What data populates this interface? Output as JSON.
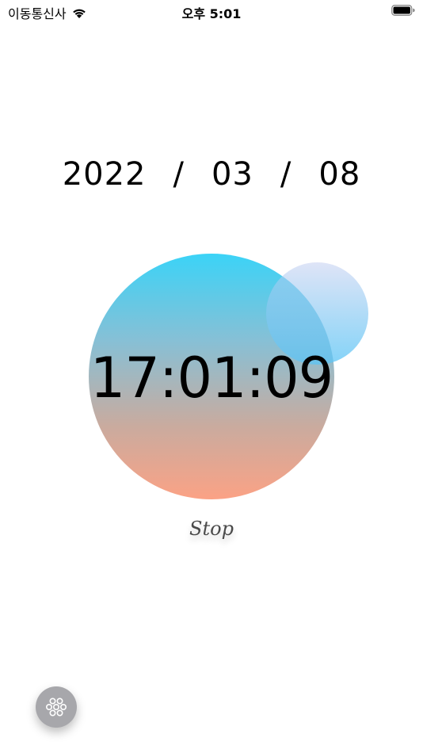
{
  "status_bar": {
    "carrier": "이동통신사",
    "time": "오후 5:01",
    "icons": [
      "wifi-icon",
      "battery-icon"
    ]
  },
  "date": {
    "year": "2022",
    "separator": "/",
    "month": "03",
    "day": "08"
  },
  "clock": {
    "time": "17:01:09"
  },
  "controls": {
    "stop_label": "Stop",
    "menu_icon": "flower-menu-icon"
  },
  "colors": {
    "circle_top": "#3bd3f7",
    "circle_bottom": "#fba285",
    "small_circle": "#5ac4f5",
    "fab": "#a7a7ab"
  }
}
